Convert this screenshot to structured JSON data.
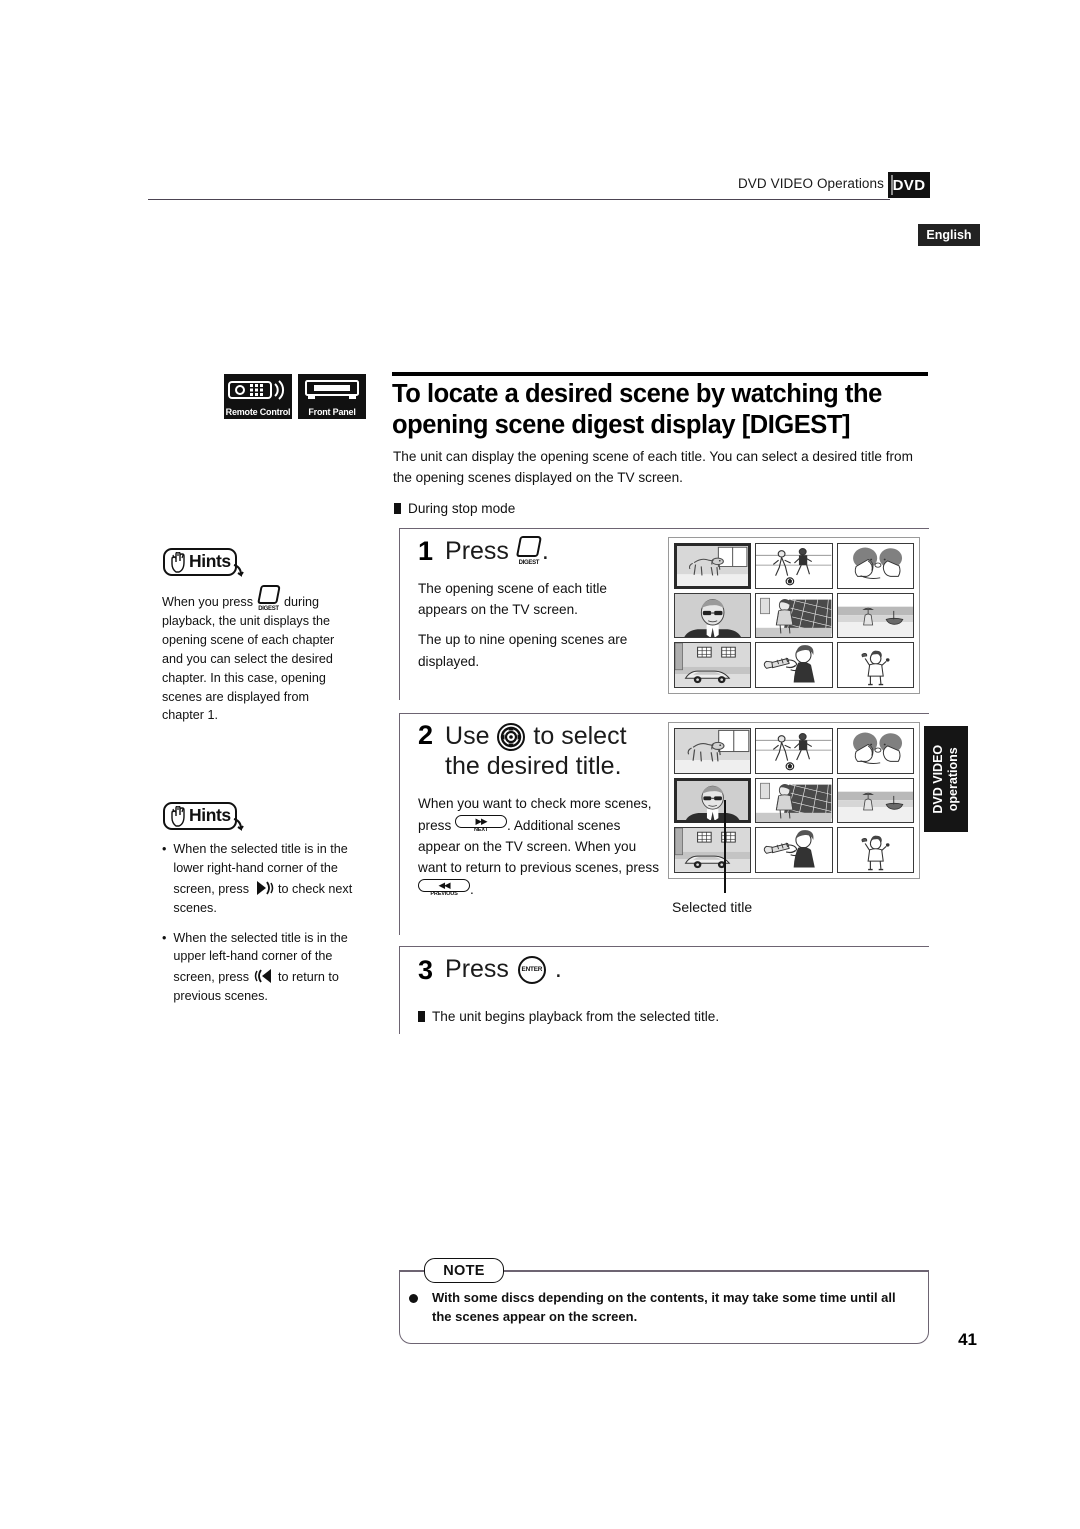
{
  "header": {
    "title": "DVD VIDEO Operations",
    "disc_badge": "DVD",
    "language_badge": "English"
  },
  "side_tab": {
    "line1": "DVD VIDEO",
    "line2": "operations"
  },
  "device_badges": [
    {
      "icon": "remote-control-icon",
      "label": "Remote Control"
    },
    {
      "icon": "front-panel-icon",
      "label": "Front Panel"
    }
  ],
  "title": {
    "heading": "To locate a desired scene by watching the opening scene digest display [DIGEST]",
    "intro": "The unit can display the opening scene of each title.  You can select a desired title from the opening scenes displayed on the TV screen.",
    "mode_heading": "During stop mode"
  },
  "steps": [
    {
      "number": "1",
      "head_prefix": "Press",
      "head_button": "DIGEST",
      "head_suffix": ".",
      "body": [
        "The opening scene of each title appears on the TV screen.",
        "The up to nine opening scenes are displayed."
      ]
    },
    {
      "number": "2",
      "head_prefix": "Use",
      "head_button": "cursor-pad",
      "head_suffix": "to select the desired title.",
      "body_runs": [
        "When you want to check more scenes, press ",
        "NEXT",
        ".  Additional scenes appear on the TV screen. When you want to return to previous scenes, press ",
        "PREVIOUS",
        "."
      ]
    },
    {
      "number": "3",
      "head_prefix": "Press",
      "head_button": "ENTER",
      "head_suffix": ".",
      "result": "The unit begins playback from the selected title."
    }
  ],
  "hints": [
    {
      "label": "Hints",
      "runs": [
        "When you press ",
        "DIGEST",
        " during playback, the unit displays the opening scene of each chapter and you can select the desired chapter. In this case, opening scenes are displayed from chapter 1."
      ]
    },
    {
      "label": "Hints",
      "items": [
        {
          "runs": [
            "When the selected title is in the lower right-hand corner of the screen, press ",
            "skip-forward",
            " to check next scenes."
          ]
        },
        {
          "runs": [
            "When the selected title is in the upper left-hand corner of the screen, press ",
            "skip-back",
            " to return to previous scenes."
          ]
        }
      ]
    }
  ],
  "illustrations": {
    "scene_names": [
      "dog-in-room",
      "soccer-players",
      "couple-kissing",
      "man-with-sunglasses",
      "man-by-fence",
      "beach-with-boat",
      "car-on-street",
      "trumpet-player",
      "person-waving"
    ],
    "grid1_selected_index": 0,
    "grid2_selected_index": 3,
    "selected_caption": "Selected title"
  },
  "note": {
    "tab_label": "NOTE",
    "text": "With some discs depending on the contents, it may take some time until all the scenes appear on the screen."
  },
  "page_number": "41"
}
